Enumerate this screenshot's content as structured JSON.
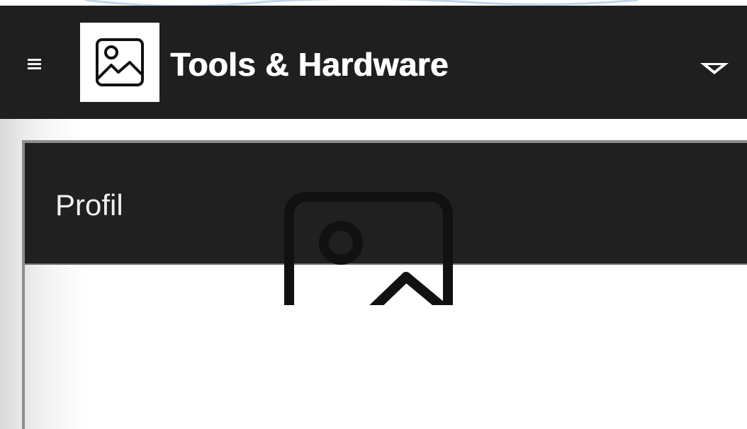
{
  "navbar": {
    "brand": "Tools & Hardware",
    "menu_icon": "hamburger-menu-icon",
    "logo_icon": "image-placeholder-icon",
    "dropdown_icon": "caret-down-icon",
    "background": "#1f1f1f"
  },
  "profile": {
    "title": "Profil",
    "image_icon": "image-placeholder-icon"
  }
}
